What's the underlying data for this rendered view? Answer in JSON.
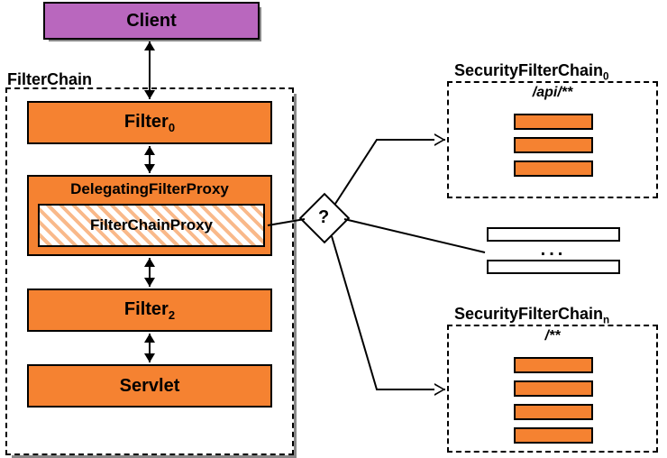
{
  "client": {
    "label": "Client"
  },
  "filterChain": {
    "label": "FilterChain",
    "filter0": "Filter",
    "filter0_sub": "0",
    "delegatingFilterProxy": "DelegatingFilterProxy",
    "filterChainProxy": "FilterChainProxy",
    "filter2": "Filter",
    "filter2_sub": "2",
    "servlet": "Servlet"
  },
  "decision": {
    "symbol": "?"
  },
  "securityFilterChains": {
    "chain0": {
      "label": "SecurityFilterChain",
      "label_sub": "0",
      "pattern": "/api/**",
      "filter_count": 3
    },
    "chainN": {
      "label": "SecurityFilterChain",
      "label_sub": "n",
      "pattern": "/**",
      "filter_count": 4
    }
  },
  "ellipsis": "..."
}
